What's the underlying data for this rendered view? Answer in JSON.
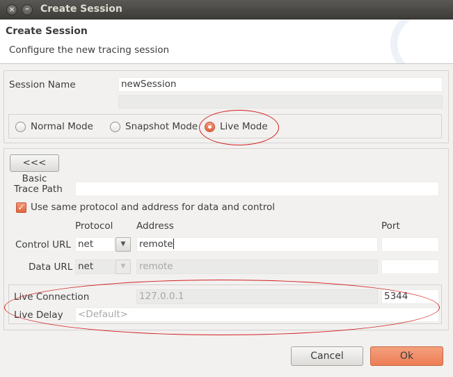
{
  "window": {
    "title": "Create Session"
  },
  "header": {
    "title": "Create Session",
    "description": "Configure the new tracing session"
  },
  "session": {
    "name_label": "Session Name",
    "name_value": "newSession"
  },
  "modes": {
    "normal_label": "Normal Mode",
    "snapshot_label": "Snapshot Mode",
    "live_label": "Live Mode",
    "selected": "Live Mode"
  },
  "advanced": {
    "basic_button": "<<< Basic",
    "trace_path_label": "Trace Path",
    "trace_path_value": "",
    "same_protocol_label": "Use same protocol and address for data and control",
    "same_protocol_checked": true,
    "col_protocol": "Protocol",
    "col_address": "Address",
    "col_port": "Port",
    "control_url": {
      "label": "Control URL",
      "protocol": "net",
      "address": "remote",
      "port": ""
    },
    "data_url": {
      "label": "Data URL",
      "protocol": "net",
      "address": "remote",
      "port": ""
    }
  },
  "live": {
    "connection_label": "Live Connection",
    "connection_address": "127.0.0.1",
    "connection_port": "5344",
    "delay_label": "Live Delay",
    "delay_placeholder": "<Default>"
  },
  "footer": {
    "cancel_label": "Cancel",
    "ok_label": "Ok"
  },
  "colors": {
    "accent": "#ec7d55",
    "annotation": "#d11e1e"
  },
  "icons": {
    "minimize": "minimize-icon",
    "close": "close-icon",
    "dropdown": "chevron-down-icon"
  }
}
